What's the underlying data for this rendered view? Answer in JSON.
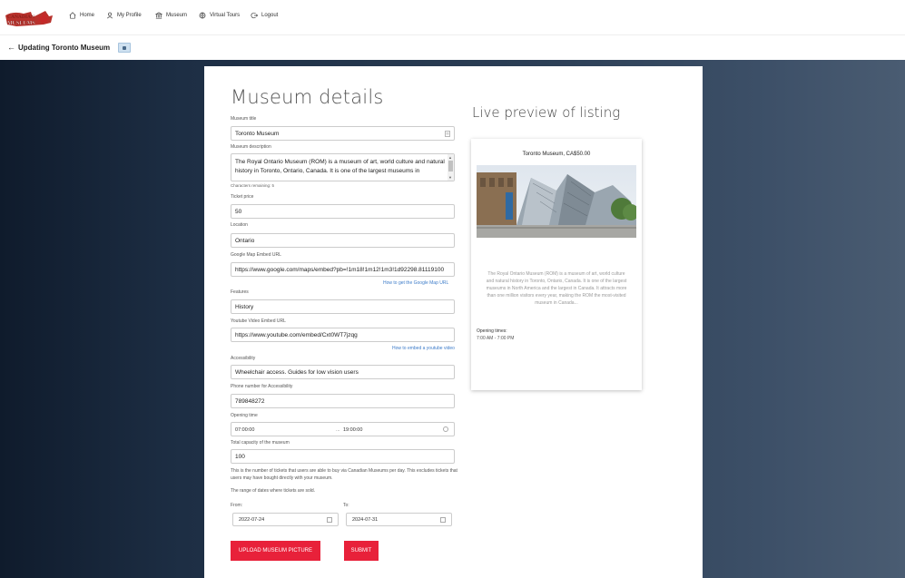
{
  "nav": {
    "logo_text": "CANADIAN MUSEUMS",
    "home": "Home",
    "profile": "My Profile",
    "museum": "Museum",
    "tours": "Virtual Tours",
    "logout": "Logout"
  },
  "header": {
    "back": "←",
    "title": "Updating Toronto Museum"
  },
  "form": {
    "heading": "Museum details",
    "title_label": "Museum title",
    "title_value": "Toronto Museum",
    "desc_label": "Museum description",
    "desc_value": "The Royal Ontario Museum (ROM) is a museum of art, world culture and natural history in Toronto, Ontario, Canada. It is one of the largest museums in",
    "chars_remaining": "Characters remaining: 5",
    "price_label": "Ticket price",
    "price_value": "50",
    "location_label": "Location",
    "location_value": "Ontario",
    "map_label": "Google Map Embed URL",
    "map_value": "https://www.google.com/maps/embed?pb=!1m18!1m12!1m3!1d92298.81119100",
    "map_help": "How to get the Google Map URL",
    "features_label": "Features",
    "features_value": "History",
    "youtube_label": "Youtube Video Embed URL",
    "youtube_value": "https://www.youtube.com/embed/Cxt0WT7jzqg",
    "youtube_help": "How to embed a youtube video",
    "access_label": "Accessibility",
    "access_value": "Wheelchair access. Guides for low vision users",
    "phone_label": "Phone number for Accessibility",
    "phone_value": "789848272",
    "opening_label": "Opening time",
    "open_from": "07:00:00",
    "open_sep": "...",
    "open_to": "19:00:00",
    "capacity_label": "Total capacity of the museum",
    "capacity_value": "100",
    "capacity_note": "This is the number of tickets that users are able to buy via Canadian Museums per day. This excludes tickets that users may have bought directly with your museum.",
    "range_note": "The range of dates where tickets are sold.",
    "from_label": "From:",
    "from_value": "2022-07-24",
    "to_label": "To:",
    "to_value": "2024-07-31",
    "upload_label": "UPLOAD MUSEUM PICTURE",
    "submit_label": "SUBMIT"
  },
  "preview": {
    "heading": "Live preview of listing",
    "card_title": "Toronto Museum, CA$50.00",
    "description": "The Royal Ontario Museum (ROM) is a museum of art, world culture and natural history in Toronto, Ontario, Canada. It is one of the largest museums in North America and the largest in Canada. It attracts more than one million visitors every year, making the ROM the most-visited museum in Canada...",
    "opening_label": "Opening times:",
    "opening_value": "7:00 AM - 7:00 PM"
  },
  "colors": {
    "accent": "#e8213a",
    "link": "#3d7cc9"
  }
}
